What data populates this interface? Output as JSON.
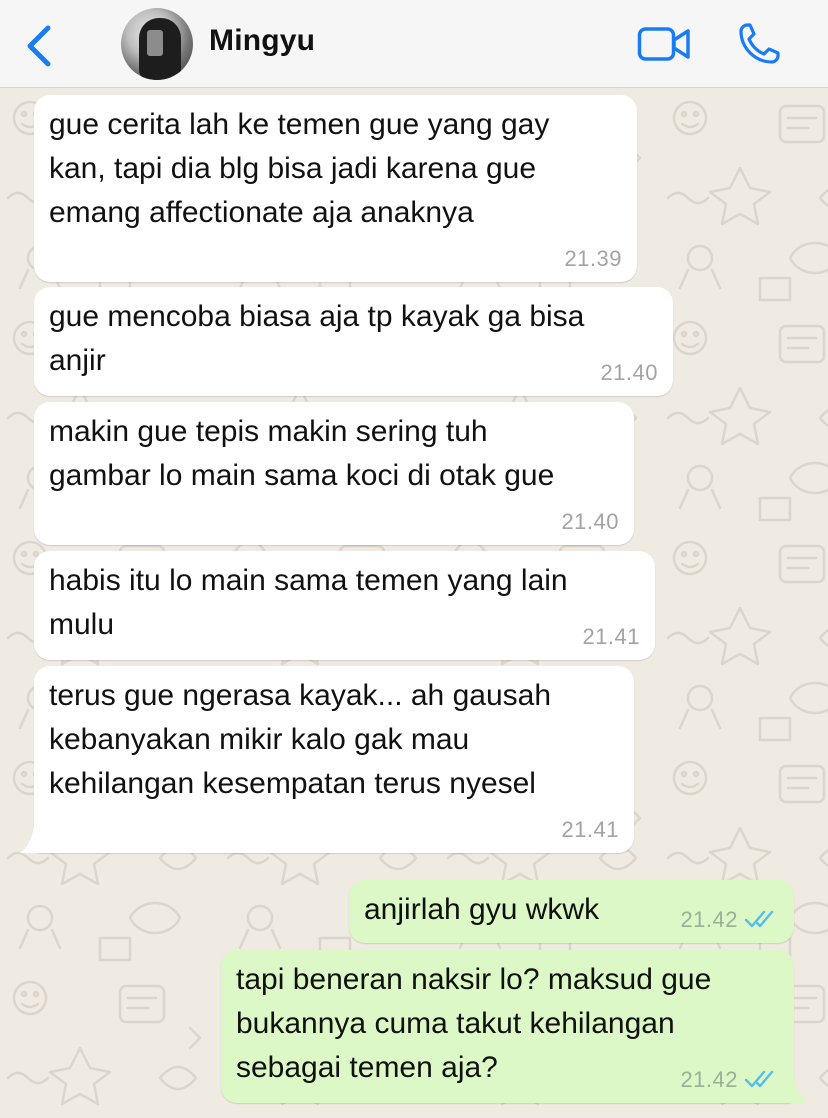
{
  "header": {
    "contact_name": "Mingyu",
    "back_icon": "chevron-left-icon",
    "video_icon": "video-camera-icon",
    "call_icon": "phone-icon",
    "accent_color": "#1a7cf5"
  },
  "messages": [
    {
      "direction": "incoming",
      "text": "gue cerita lah ke temen gue yang gay\nkan, tapi dia blg bisa jadi karena gue\nemang affectionate aja anaknya",
      "time": "21.39"
    },
    {
      "direction": "incoming",
      "text": "gue mencoba biasa aja tp kayak ga bisa\nanjir",
      "time": "21.40"
    },
    {
      "direction": "incoming",
      "text": "makin gue tepis makin sering tuh\ngambar lo main sama koci di otak gue",
      "time": "21.40"
    },
    {
      "direction": "incoming",
      "text": "habis itu lo main sama temen yang lain\nmulu",
      "time": "21.41"
    },
    {
      "direction": "incoming",
      "text": "terus gue ngerasa kayak... ah gausah\nkebanyakan mikir kalo gak mau\nkehilangan kesempatan terus nyesel",
      "time": "21.41"
    },
    {
      "direction": "outgoing",
      "text": "anjirlah gyu wkwk",
      "time": "21.42",
      "status": "read"
    },
    {
      "direction": "outgoing",
      "text": "tapi beneran naksir lo? maksud gue\nbukannya cuma takut kehilangan\nsebagai temen aja?",
      "time": "21.42",
      "status": "read"
    }
  ],
  "colors": {
    "incoming_bubble": "#ffffff",
    "outgoing_bubble": "#dcf8c6",
    "read_ticks": "#53bdeb",
    "wallpaper": "#efeae2"
  }
}
